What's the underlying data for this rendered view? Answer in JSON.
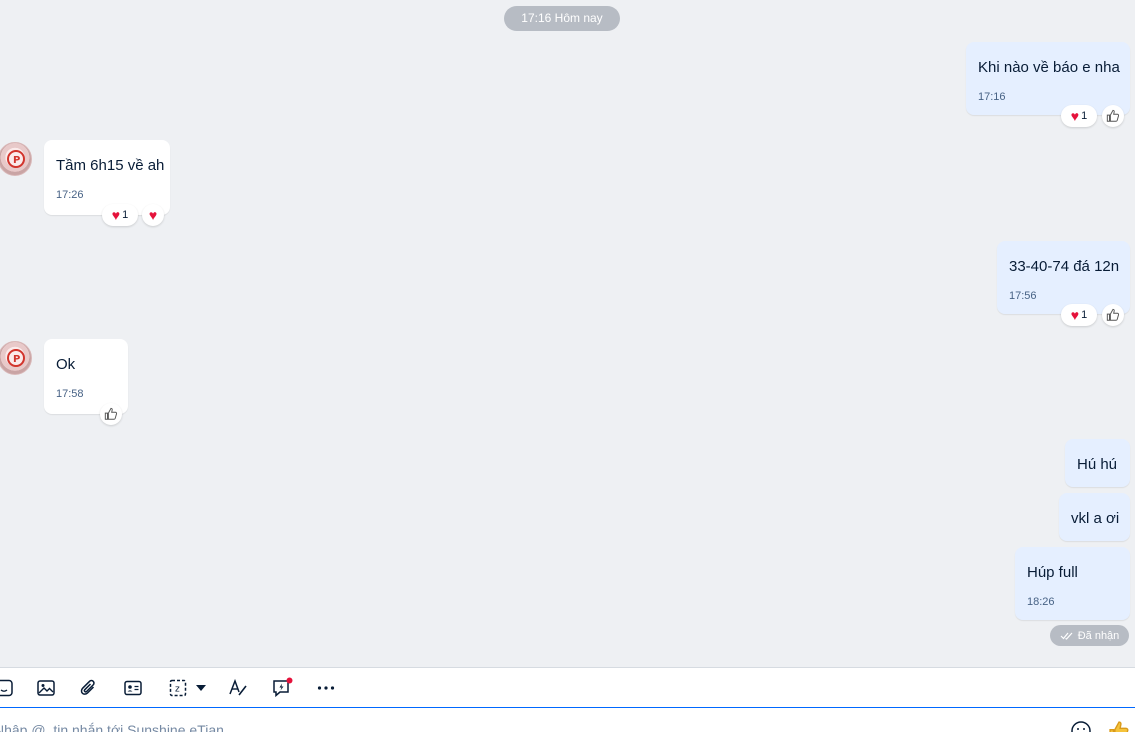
{
  "chat": {
    "date_separator": "17:16 Hôm nay",
    "messages": [
      {
        "text": "Khi nào về báo e nha",
        "time": "17:16",
        "reaction_count": "1"
      },
      {
        "text": "Tầm 6h15 về ah",
        "time": "17:26",
        "reaction_count": "1"
      },
      {
        "text": "33-40-74 đá 12n",
        "time": "17:56",
        "reaction_count": "1"
      },
      {
        "text": "Ok",
        "time": "17:58"
      },
      {
        "text": "Hú hú"
      },
      {
        "text": "vkl a ơi"
      },
      {
        "text": "Húp full",
        "time": "18:26"
      }
    ],
    "status": "Đã nhận"
  },
  "toolbar": {
    "icons": [
      "sticker-icon",
      "image-icon",
      "attachment-icon",
      "contact-card-icon",
      "screenshot-icon",
      "dropdown-icon",
      "format-text-icon",
      "quick-message-icon",
      "more-icon"
    ]
  },
  "composer": {
    "placeholder": "Nhập @, tin nhắn tới Sunshine eTian"
  },
  "colors": {
    "own_bubble": "#e5efff",
    "other_bubble": "#ffffff",
    "background": "#eef0f3",
    "heart": "#e5123b",
    "accent": "#0068ff"
  }
}
